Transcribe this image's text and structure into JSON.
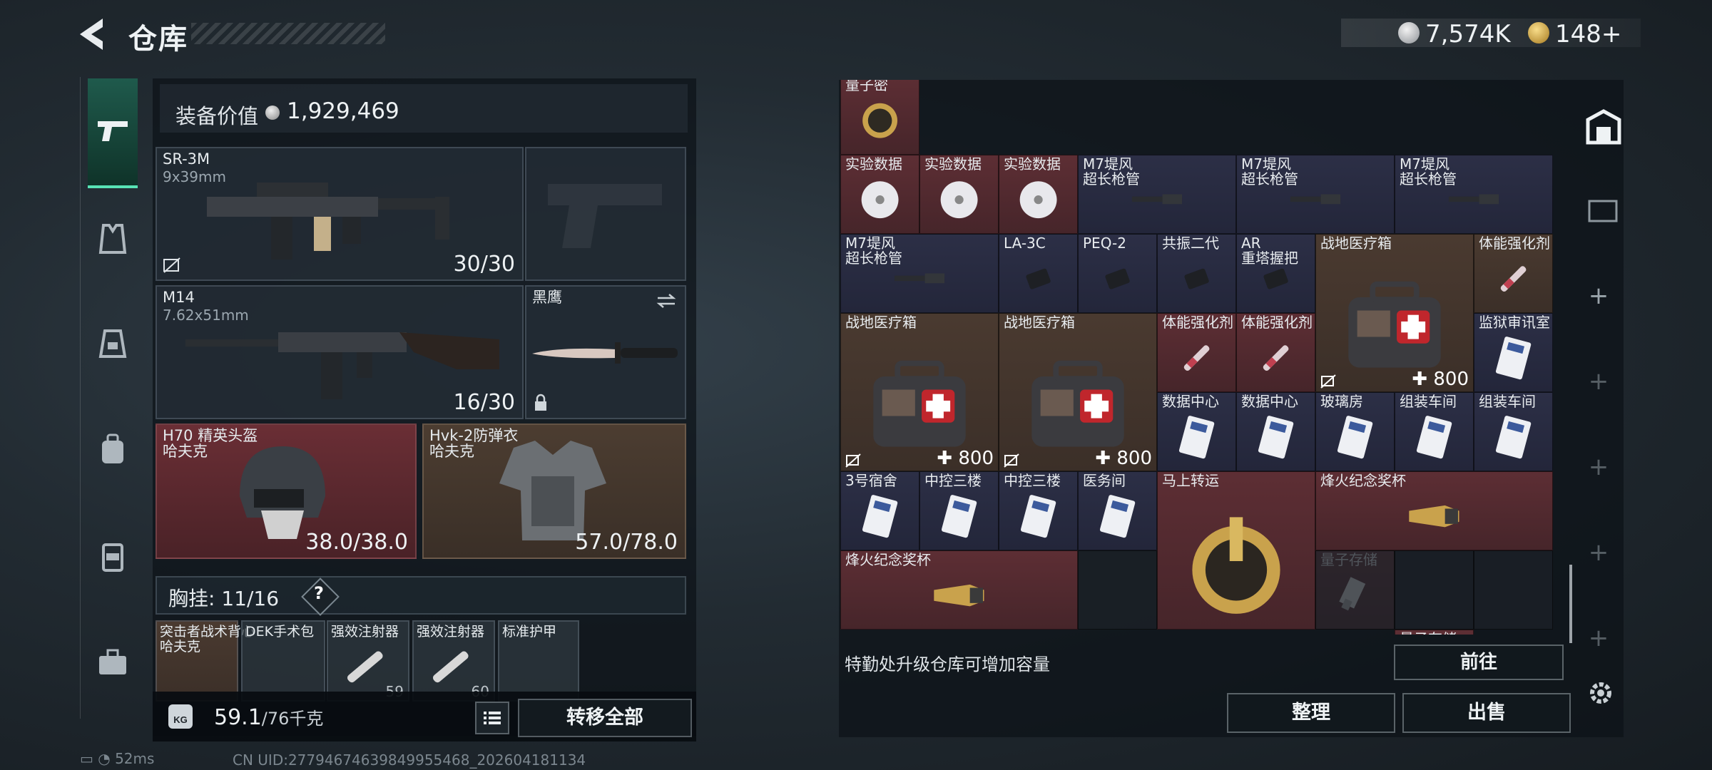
{
  "header": {
    "title": "仓库",
    "currency": [
      {
        "icon": "silver-coin-icon",
        "value": "7,574K"
      },
      {
        "icon": "gold-coin-icon",
        "value": "148+"
      }
    ]
  },
  "sidebar": {
    "items": [
      {
        "icon": "pistol-icon",
        "selected": true
      },
      {
        "icon": "vest-icon"
      },
      {
        "icon": "chest-rig-icon"
      },
      {
        "icon": "backpack-icon"
      },
      {
        "icon": "pouch-icon"
      },
      {
        "icon": "case-icon"
      }
    ]
  },
  "loadout": {
    "value_label": "装备价值",
    "value": "1,929,469",
    "primary": {
      "name": "SR-3M",
      "caliber": "9x39mm",
      "ammo": "30/30"
    },
    "secondary": {
      "name": "M14",
      "caliber": "7.62x51mm",
      "ammo": "16/30"
    },
    "melee": {
      "name": "黑鹰"
    },
    "helmet": {
      "name": "H70 精英头盔",
      "brand": "哈夫克",
      "durability": "38.0/38.0"
    },
    "armor": {
      "name": "Hvk-2防弹衣",
      "brand": "哈夫克",
      "durability": "57.0/78.0"
    },
    "chest_rig": {
      "label": "胸挂:",
      "value": "11/16",
      "help": "?"
    },
    "rig_items": [
      {
        "label": "突击者战术背心\n哈夫克"
      },
      {
        "label": "DEK手术包"
      },
      {
        "label": "强效注射器",
        "count": "59"
      },
      {
        "label": "强效注射器",
        "count": "60"
      },
      {
        "label": "标准护甲"
      }
    ],
    "weight": "59.1",
    "weight_max": "/76千克",
    "transfer_all": "转移全部"
  },
  "storage": {
    "rows": [
      [
        {
          "label": "量子密",
          "color": "red",
          "art": "disc-gold"
        },
        {
          "label": "量子存储",
          "color": "red",
          "art": "usb"
        },
        {
          "label": "量子存储",
          "color": "red",
          "art": "usb"
        },
        {
          "label": "量子存储",
          "color": "red",
          "art": "usb"
        },
        {
          "label": "量子存储",
          "color": "red",
          "art": "usb"
        },
        {
          "label": "量子存储",
          "color": "red",
          "art": "usb"
        },
        {
          "label": "量子存储",
          "color": "red",
          "art": "usb"
        },
        {
          "label": "量子存储",
          "color": "red",
          "art": "usb"
        },
        {
          "label": "实验数据",
          "color": "red",
          "art": "cd"
        }
      ]
    ],
    "items": [
      {
        "label": "实验数据",
        "color": "red",
        "art": "cd"
      },
      {
        "label": "实验数据",
        "color": "red",
        "art": "cd"
      },
      {
        "label": "实验数据",
        "color": "red",
        "art": "cd"
      },
      {
        "label": "M7堤风\n超长枪管",
        "color": "blue"
      },
      {
        "label": "M7堤风\n超长枪管",
        "color": "blue"
      },
      {
        "label": "M7堤风\n超长枪管",
        "color": "blue"
      },
      {
        "label": "M7堤风\n超长枪管",
        "color": "blue"
      },
      {
        "label": "LA-3C",
        "color": "blue"
      },
      {
        "label": "PEQ-2",
        "color": "blue"
      },
      {
        "label": "共振二代",
        "color": "blue"
      },
      {
        "label": "AR\n重塔握把",
        "color": "blue"
      },
      {
        "label": "战地医疗箱",
        "color": "brown",
        "count": "800"
      },
      {
        "label": "体能强化剂",
        "color": "brown"
      },
      {
        "label": "战地医疗箱",
        "color": "brown",
        "count": "800"
      },
      {
        "label": "战地医疗箱",
        "color": "brown",
        "count": "800"
      },
      {
        "label": "体能强化剂",
        "color": "red"
      },
      {
        "label": "体能强化剂",
        "color": "red"
      },
      {
        "label": "监狱审讯室",
        "color": "blue"
      },
      {
        "label": "数据中心",
        "color": "blue"
      },
      {
        "label": "数据中心",
        "color": "blue"
      },
      {
        "label": "玻璃房",
        "color": "blue"
      },
      {
        "label": "组装车间",
        "color": "blue"
      },
      {
        "label": "组装车间",
        "color": "blue"
      },
      {
        "label": "3号宿舍",
        "color": "blue"
      },
      {
        "label": "中控三楼",
        "color": "blue"
      },
      {
        "label": "中控三楼",
        "color": "blue"
      },
      {
        "label": "医务间",
        "color": "blue"
      },
      {
        "label": "马上转运",
        "color": "red"
      },
      {
        "label": "烽火纪念奖杯",
        "color": "red"
      },
      {
        "label": "烽火纪念奖杯",
        "color": "red"
      }
    ],
    "upgrade_hint": "特勤处升级仓库可增加容量",
    "goto": "前往",
    "sort": "整理",
    "sell": "出售"
  },
  "status": {
    "ping": "52ms",
    "uid": "CN UID:27794674639849955468_202604181134"
  }
}
